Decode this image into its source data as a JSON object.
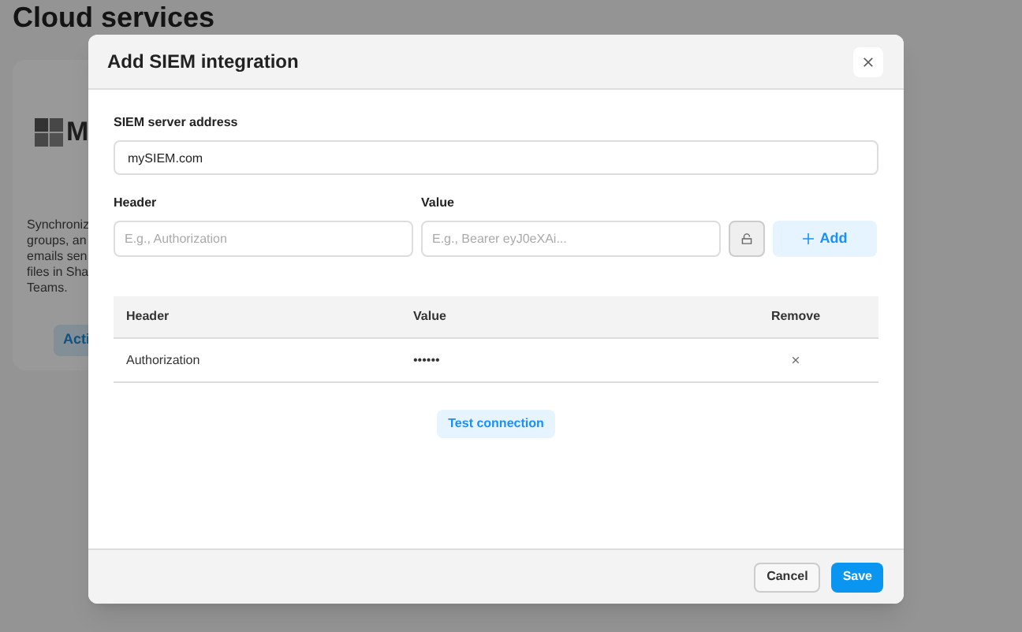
{
  "background": {
    "title": "Cloud services",
    "card": {
      "name": "M",
      "description_lines": [
        "Synchroniz",
        "groups, an",
        "emails sen",
        "files in Sha",
        "Teams."
      ],
      "button": "Acti"
    }
  },
  "dialog": {
    "title": "Add SIEM integration",
    "server": {
      "label": "SIEM server address",
      "value": "mySIEM.com"
    },
    "header_field": {
      "label": "Header",
      "placeholder": "E.g., Authorization"
    },
    "value_field": {
      "label": "Value",
      "placeholder": "E.g., Bearer eyJ0eXAi..."
    },
    "add_button": "Add",
    "table": {
      "columns": [
        "Header",
        "Value",
        "Remove"
      ],
      "rows": [
        {
          "header": "Authorization",
          "value": "••••••"
        }
      ]
    },
    "test_button": "Test connection",
    "buttons": [
      {
        "label": "Cancel",
        "kind": "secondary"
      },
      {
        "label": "Save",
        "kind": "primary"
      }
    ]
  }
}
